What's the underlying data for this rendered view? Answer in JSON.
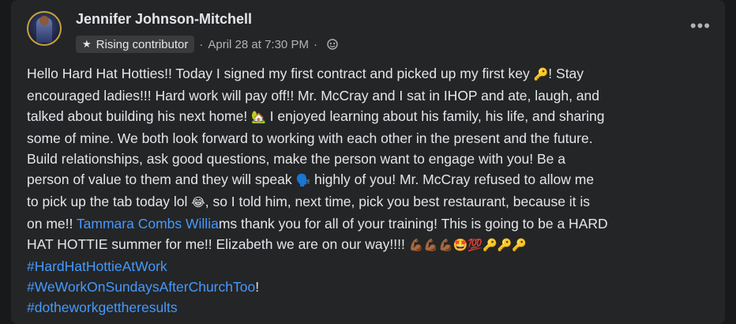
{
  "post": {
    "author": "Jennifer Johnson-Mitchell",
    "badge": "Rising contributor",
    "date": "April 28 at 7:30 PM",
    "dot": "·",
    "more": "•••"
  },
  "content": {
    "l1a": "Hello Hard Hat Hotties!! Today I signed my first contract and picked up my first key ",
    "l1e": "🔑",
    "l1b": "! Stay",
    "l2": "encouraged ladies!!! Hard work will pay off!! Mr. McCray and I sat in IHOP and ate, laugh, and",
    "l3a": "talked about building his next home! ",
    "l3e": "🏡",
    "l3b": " I enjoyed learning about his family, his life, and sharing",
    "l4": "some of mine. We both look forward to working with each other in the present and the future.",
    "l5": "Build relationships, ask good questions, make the person want to engage with you! Be a",
    "l6a": "person of value to them and they will speak ",
    "l6e": "🗣️",
    "l6b": " highly of you! Mr. McCray refused to allow me",
    "l7a": "to pick up the tab today lol ",
    "l7e": "😂",
    "l7b": ", so I told him, next time, pick you best restaurant, because it is",
    "l8a": "on me!! ",
    "mention": "Tammara Combs Willia",
    "l8b": "ms thank you for all of your training! This is going to be a HARD",
    "l9a": "HAT HOTTIE summer for me!! Elizabeth we are on our way!!!! ",
    "l9e": "💪🏾💪🏾💪🏾🤩💯🔑🔑🔑",
    "tag1": "#HardHatHottieAtWork",
    "tag2": "#WeWorkOnSundaysAfterChurchToo",
    "tag2_after": "!",
    "tag3": "#dotheworkgettheresults"
  }
}
